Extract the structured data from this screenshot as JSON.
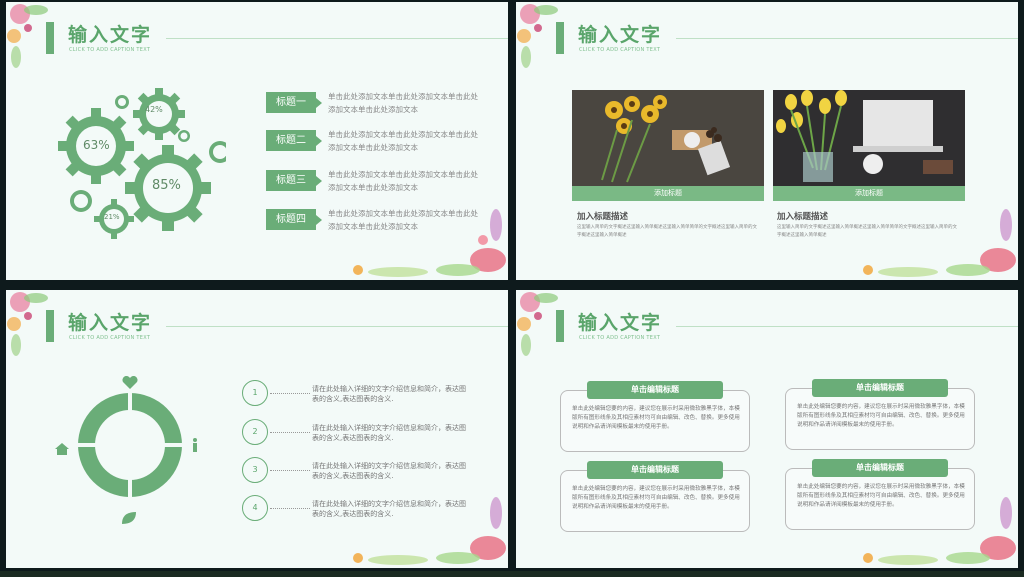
{
  "slides": [
    {
      "title": "输入文字",
      "subtitle": "CLICK TO ADD CAPTION TEXT",
      "gears": [
        "63%",
        "42%",
        "85%",
        "21%"
      ],
      "items": [
        {
          "tag": "标题一",
          "text": "单击此处添加文本单击此处添加文本单击此处添加文本单击此处添加文本"
        },
        {
          "tag": "标题二",
          "text": "单击此处添加文本单击此处添加文本单击此处添加文本单击此处添加文本"
        },
        {
          "tag": "标题三",
          "text": "单击此处添加文本单击此处添加文本单击此处添加文本单击此处添加文本"
        },
        {
          "tag": "标题四",
          "text": "单击此处添加文本单击此处添加文本单击此处添加文本单击此处添加文本"
        }
      ]
    },
    {
      "title": "输入文字",
      "subtitle": "CLICK TO ADD CAPTION TEXT",
      "cards": [
        {
          "caption": "添加标题",
          "heading": "加入标题描述",
          "text": "这里输入简单的文字概述这里输入简单概述这里输入简单简单的文字概述这里输入简单的文字概述这里输入简单概述"
        },
        {
          "caption": "添加标题",
          "heading": "加入标题描述",
          "text": "这里输入简单的文字概述这里输入简单概述这里输入简单简单的文字概述这里输入简单的文字概述这里输入简单概述"
        }
      ]
    },
    {
      "title": "输入文字",
      "subtitle": "CLICK TO ADD CAPTION TEXT",
      "steps": [
        {
          "n": "1",
          "text": "请在此处输入详细的文字介绍信息和简介，表达图表的含义,表达图表的含义."
        },
        {
          "n": "2",
          "text": "请在此处输入详细的文字介绍信息和简介，表达图表的含义,表达图表的含义."
        },
        {
          "n": "3",
          "text": "请在此处输入详细的文字介绍信息和简介，表达图表的含义,表达图表的含义."
        },
        {
          "n": "4",
          "text": "请在此处输入详细的文字介绍信息和简介，表达图表的含义,表达图表的含义."
        }
      ]
    },
    {
      "title": "输入文字",
      "subtitle": "CLICK TO ADD CAPTION TEXT",
      "boxes": [
        {
          "heading": "单击编辑标题",
          "text": "单击此处编辑您要的内容，建议您在展示时采用微软雅黑字体，本模版所有图形线条及其相应素材均可自由编辑、改色、替换。更多使用说明和作品请详阅模板最末的使用手册。"
        },
        {
          "heading": "单击编辑标题",
          "text": "单击此处编辑您要的内容，建议您在展示时采用微软雅黑字体，本模版所有图形线条及其相应素材均可自由编辑、改色、替换。更多使用说明和作品请详阅模板最末的使用手册。"
        },
        {
          "heading": "单击编辑标题",
          "text": "单击此处编辑您要的内容，建议您在展示时采用微软雅黑字体，本模版所有图形线条及其相应素材均可自由编辑、改色、替换。更多使用说明和作品请详阅模板最末的使用手册。"
        },
        {
          "heading": "单击编辑标题",
          "text": "单击此处编辑您要的内容，建议您在展示时采用微软雅黑字体，本模版所有图形线条及其相应素材均可自由编辑、改色、替换。更多使用说明和作品请详阅模板最末的使用手册。"
        }
      ]
    }
  ],
  "colors": {
    "accent": "#6aad78",
    "background": "#f3faf8",
    "frame": "#0e1a1c"
  }
}
